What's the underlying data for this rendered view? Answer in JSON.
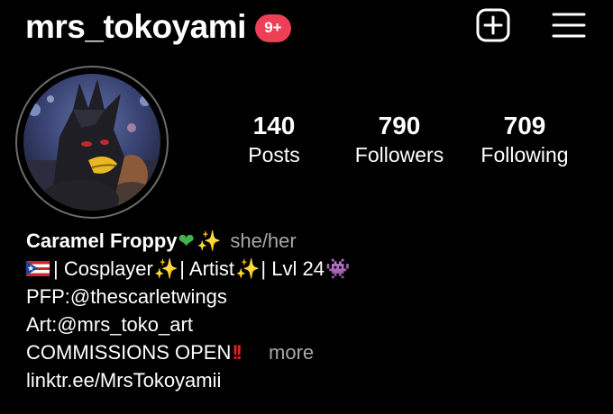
{
  "header": {
    "username": "mrs_tokoyami",
    "notification_badge": "9+",
    "new_post_icon": "plus-square-icon",
    "menu_icon": "hamburger-menu-icon"
  },
  "profile": {
    "avatar_icon": "profile-picture"
  },
  "stats": {
    "posts": {
      "count": "140",
      "label": "Posts"
    },
    "followers": {
      "count": "790",
      "label": "Followers"
    },
    "following": {
      "count": "709",
      "label": "Following"
    }
  },
  "bio": {
    "name": "Caramel Froppy",
    "pronouns": "she/her",
    "line2_part1": "|  Cosplayer",
    "line2_part2": " | Artist",
    "line2_part3": "| Lvl 24",
    "line3": "PFP:@thescarletwings",
    "line4": "Art:@mrs_toko_art",
    "line5": "COMMISSIONS OPEN",
    "more_label": "more",
    "link": "linktr.ee/MrsTokoyamii"
  },
  "colors": {
    "background": "#000000",
    "badge": "#ed3f55",
    "secondary_text": "#a8a8a8",
    "avatar_ring": "#6b6b6b"
  }
}
